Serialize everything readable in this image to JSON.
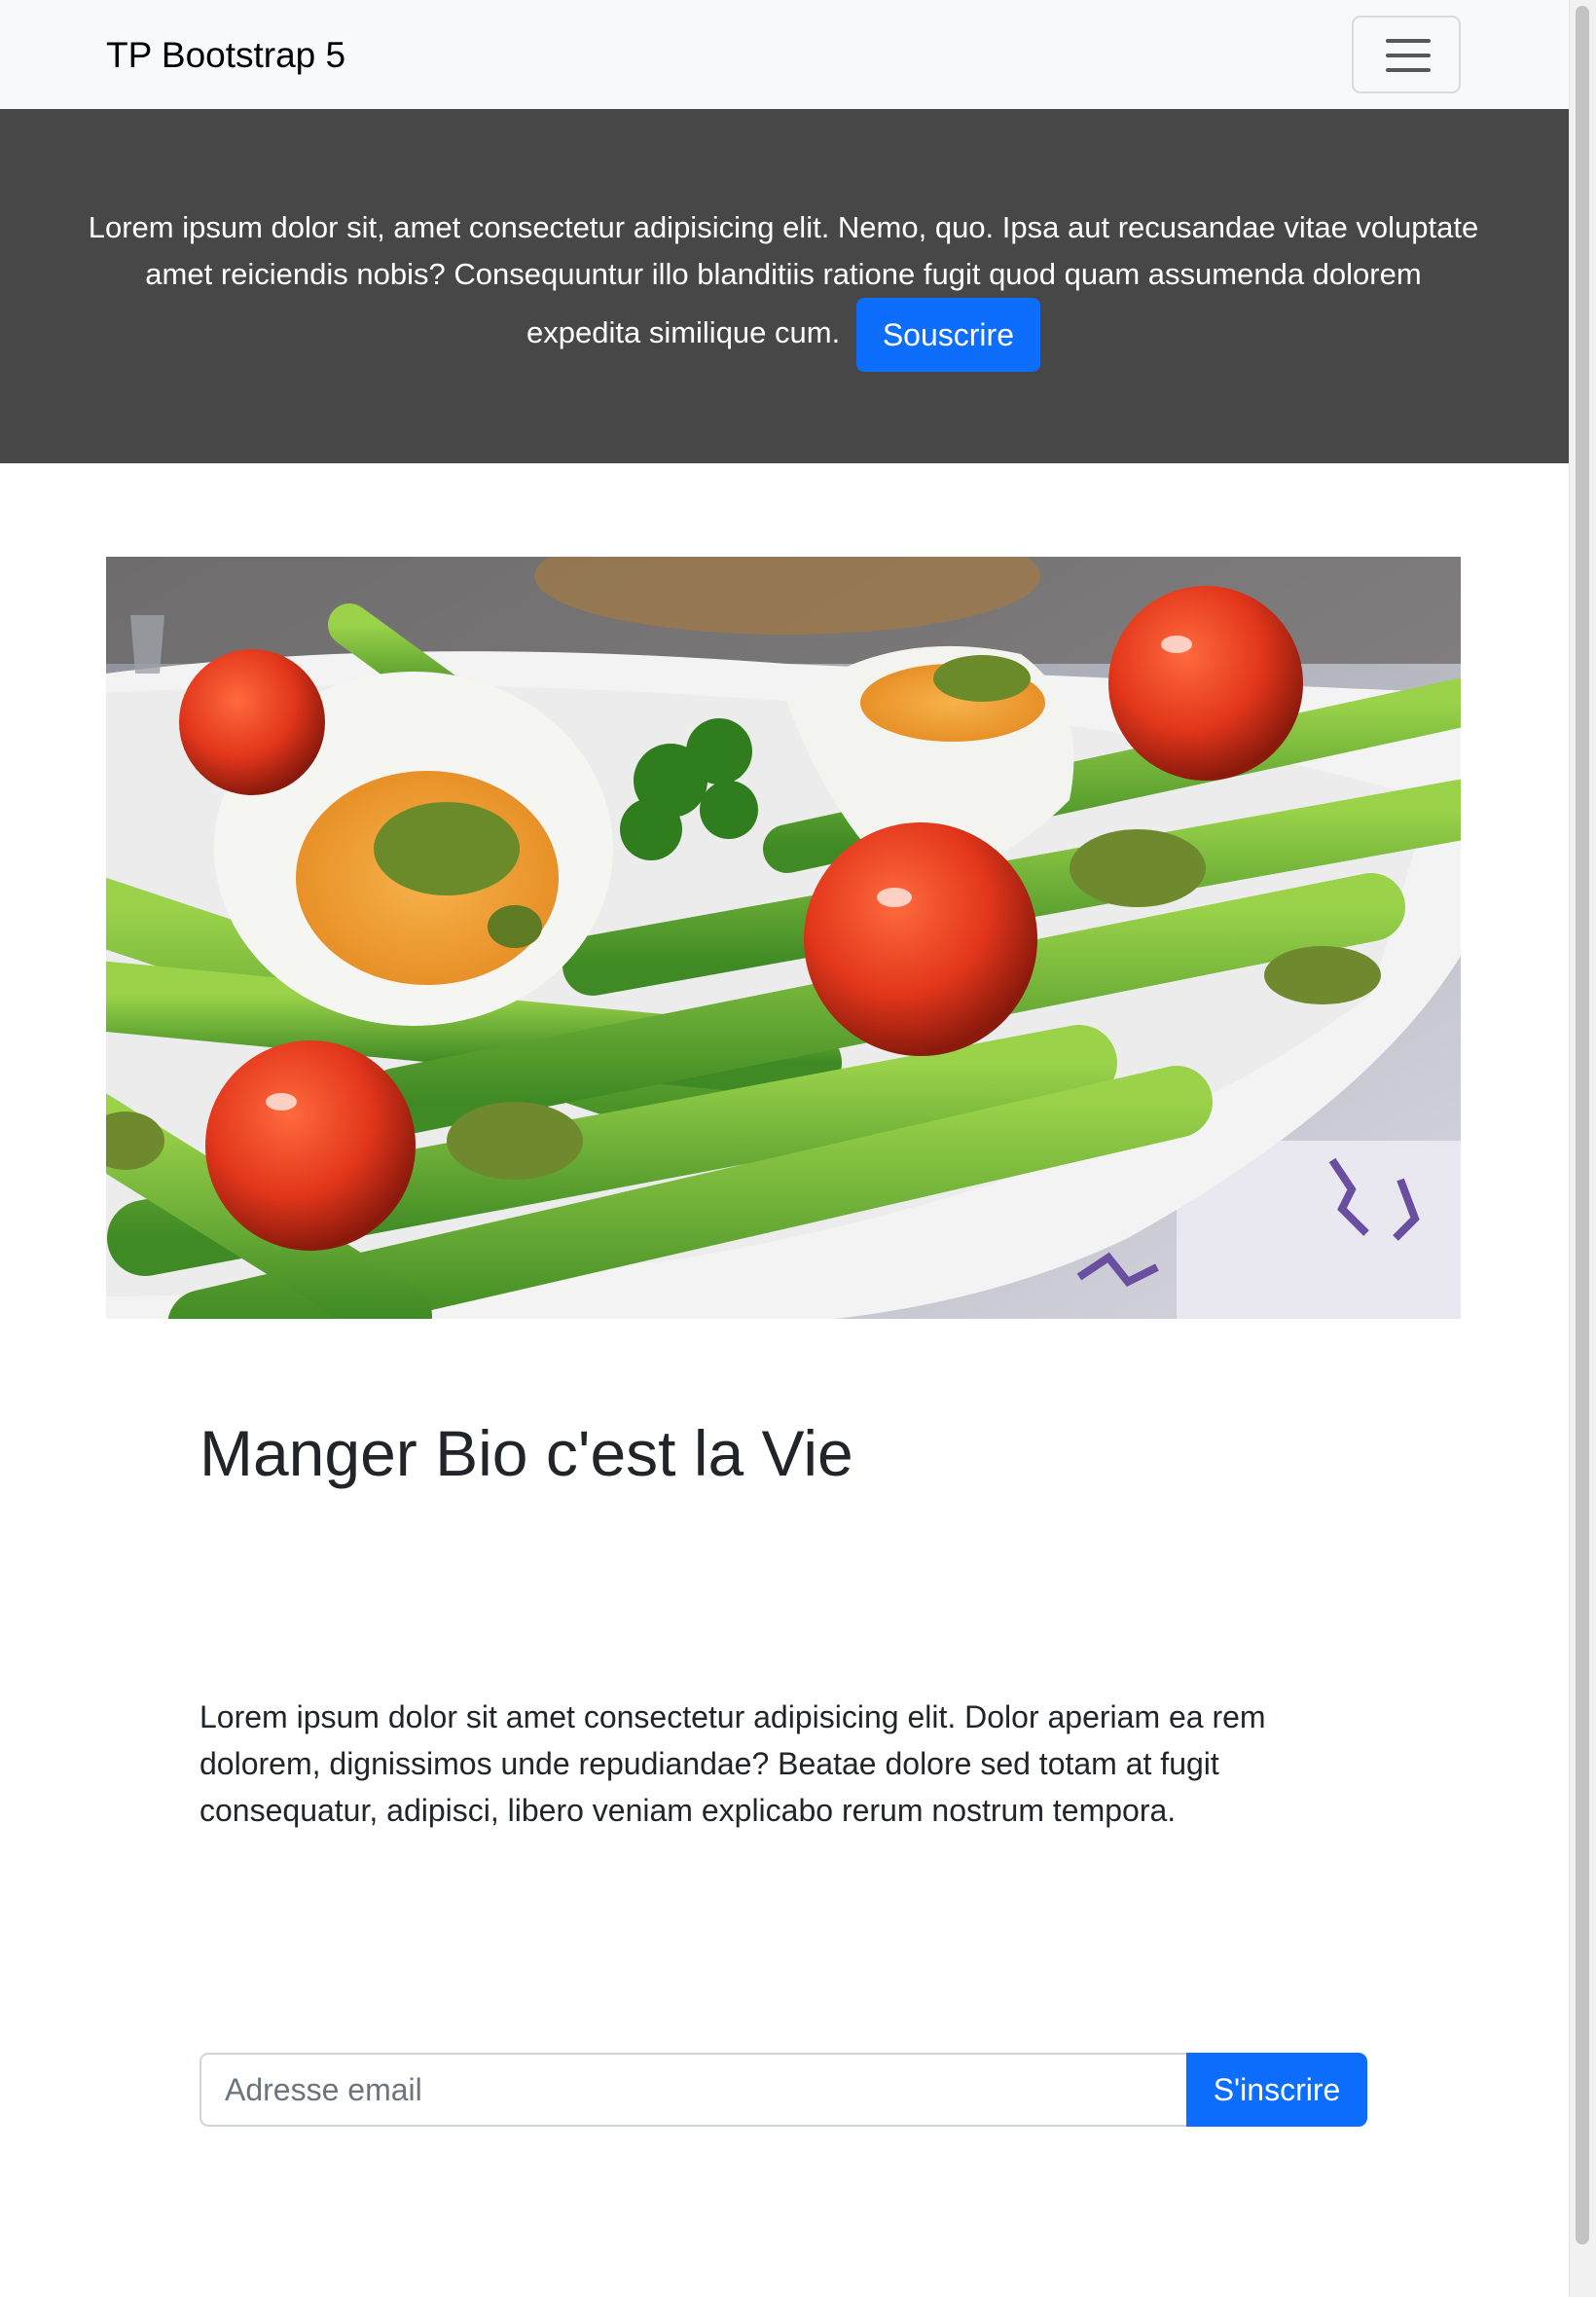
{
  "navbar": {
    "brand": "TP Bootstrap 5",
    "toggler_icon": "hamburger-menu-icon"
  },
  "hero": {
    "text": "Lorem ipsum dolor sit, amet consectetur adipisicing elit. Nemo, quo. Ipsa aut recusandae vitae voluptate amet reiciendis nobis? Consequuntur illo blanditiis ratione fugit quod quam assumenda dolorem expedita similique cum.",
    "button_label": "Souscrire"
  },
  "image": {
    "alt": "Salad with asparagus, eggs, tomatoes and pesto"
  },
  "main": {
    "title": "Manger Bio c'est la Vie",
    "paragraph": "Lorem ipsum dolor sit amet consectetur adipisicing elit. Dolor aperiam ea rem dolorem, dignissimos unde repudiandae? Beatae dolore sed totam at fugit consequatur, adipisci, libero veniam explicabo rerum nostrum tempora."
  },
  "signup": {
    "email_placeholder": "Adresse email",
    "email_value": "",
    "button_label": "S'inscrire"
  },
  "colors": {
    "navbar_bg": "#f8f9fa",
    "hero_bg": "#474747",
    "primary": "#0d6efd",
    "text": "#212529"
  }
}
